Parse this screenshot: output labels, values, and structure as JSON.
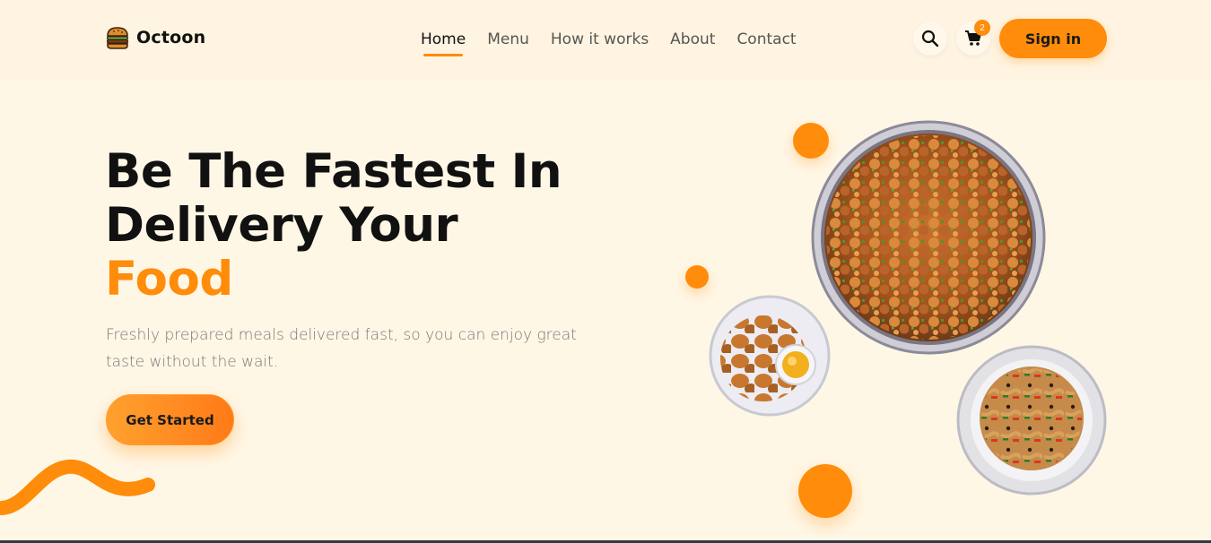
{
  "brand": {
    "name": "Octoon",
    "logo_icon": "burger-icon"
  },
  "nav": {
    "items": [
      {
        "label": "Home",
        "active": true
      },
      {
        "label": "Menu",
        "active": false
      },
      {
        "label": "How it works",
        "active": false
      },
      {
        "label": "About",
        "active": false
      },
      {
        "label": "Contact",
        "active": false
      }
    ]
  },
  "header_actions": {
    "search_icon": "search-icon",
    "cart_icon": "cart-icon",
    "cart_count": "2",
    "signin_label": "Sign in"
  },
  "hero": {
    "title_line1": "Be The Fastest In",
    "title_line2": "Delivery Your",
    "title_accent": "Food",
    "subtitle": "Freshly prepared meals delivered fast, so you can enjoy great taste without the wait.",
    "cta_label": "Get Started"
  },
  "colors": {
    "accent": "#ff8c0a",
    "background": "#fff7e6",
    "heading": "#111111",
    "body_text": "#777777"
  }
}
